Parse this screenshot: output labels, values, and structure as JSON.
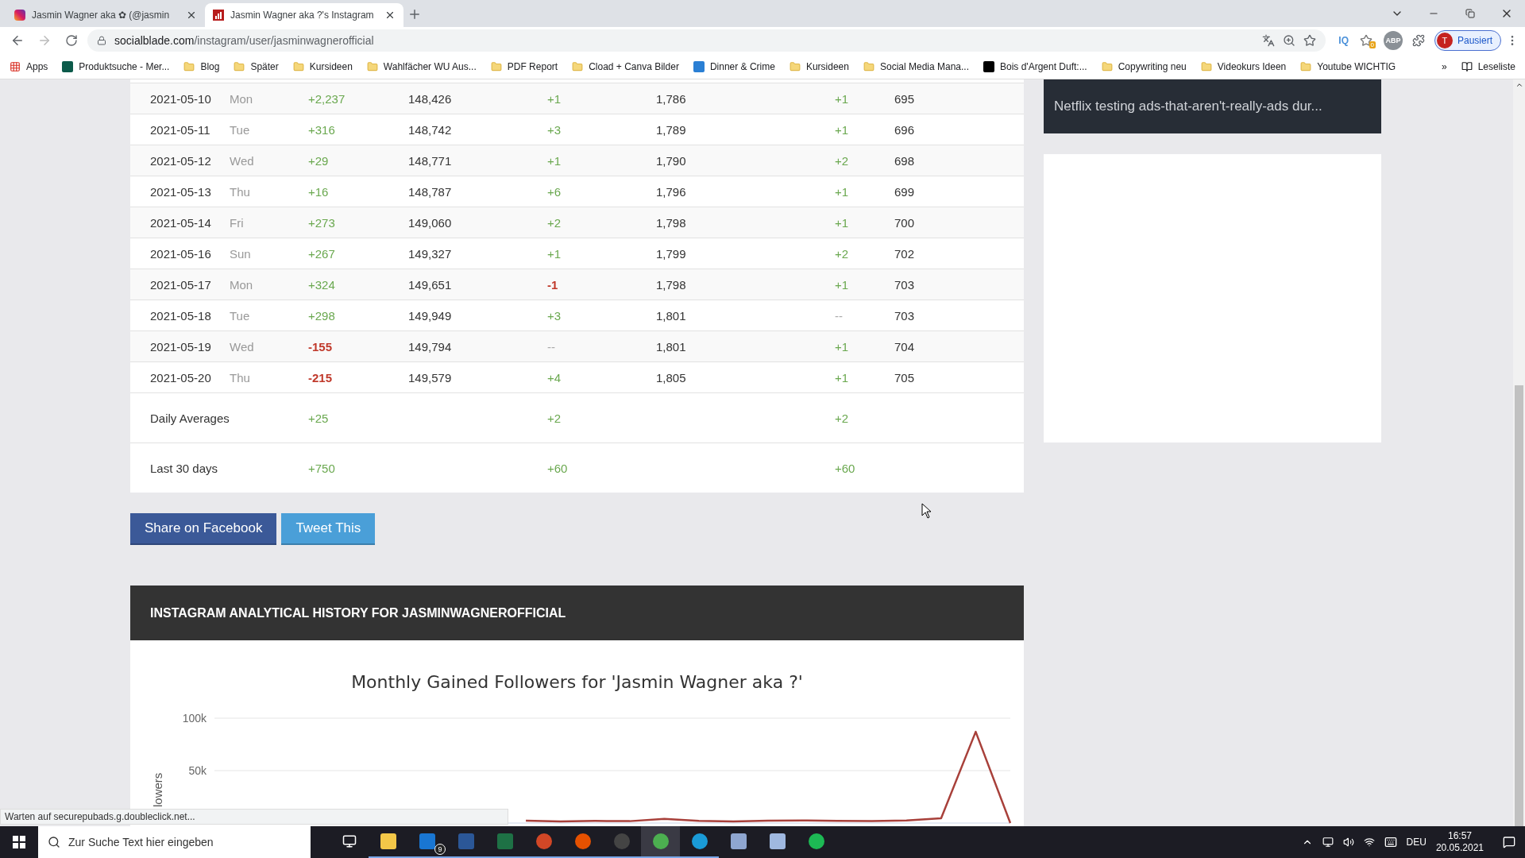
{
  "browser": {
    "tabs": [
      {
        "title": "Jasmin Wagner aka ✿ (@jasmin",
        "kind": "instagram",
        "selected": false
      },
      {
        "title": "Jasmin Wagner aka ?'s Instagram",
        "kind": "socialblade",
        "selected": true
      }
    ],
    "url": {
      "host": "socialblade.com",
      "path": "/instagram/user/jasminwagnerofficial"
    },
    "extensions": {
      "iq": "IQ",
      "badge": "0",
      "abp": "ABP"
    },
    "profile": {
      "initial": "T",
      "label": "Pausiert"
    },
    "bookmarks": [
      {
        "label": "Apps",
        "kind": "apps"
      },
      {
        "label": "Produktsuche - Mer...",
        "kind": "site"
      },
      {
        "label": "Blog",
        "kind": "folder"
      },
      {
        "label": "Später",
        "kind": "folder"
      },
      {
        "label": "Kursideen",
        "kind": "folder"
      },
      {
        "label": "Wahlfächer WU Aus...",
        "kind": "folder"
      },
      {
        "label": "PDF Report",
        "kind": "folder"
      },
      {
        "label": "Cload + Canva Bilder",
        "kind": "folder"
      },
      {
        "label": "Dinner & Crime",
        "kind": "jd"
      },
      {
        "label": "Kursideen",
        "kind": "folder"
      },
      {
        "label": "Social Media Mana...",
        "kind": "folder"
      },
      {
        "label": "Bois d'Argent Duft:...",
        "kind": "dark"
      },
      {
        "label": "Copywriting neu",
        "kind": "folder"
      },
      {
        "label": "Videokurs Ideen",
        "kind": "folder"
      },
      {
        "label": "Youtube WICHTIG",
        "kind": "folder"
      }
    ],
    "more": "»",
    "reading_list": "Leseliste"
  },
  "table": {
    "rows": [
      {
        "date": "2021-05-10",
        "day": "Mon",
        "followers_change": {
          "text": "+2,237",
          "kind": "gain"
        },
        "followers": "148,426",
        "following_change": {
          "text": "+1",
          "kind": "gain"
        },
        "following": "1,786",
        "media_change": {
          "text": "+1",
          "kind": "gain"
        },
        "media": "695"
      },
      {
        "date": "2021-05-11",
        "day": "Tue",
        "followers_change": {
          "text": "+316",
          "kind": "gain"
        },
        "followers": "148,742",
        "following_change": {
          "text": "+3",
          "kind": "gain"
        },
        "following": "1,789",
        "media_change": {
          "text": "+1",
          "kind": "gain"
        },
        "media": "696"
      },
      {
        "date": "2021-05-12",
        "day": "Wed",
        "followers_change": {
          "text": "+29",
          "kind": "gain"
        },
        "followers": "148,771",
        "following_change": {
          "text": "+1",
          "kind": "gain"
        },
        "following": "1,790",
        "media_change": {
          "text": "+2",
          "kind": "gain"
        },
        "media": "698"
      },
      {
        "date": "2021-05-13",
        "day": "Thu",
        "followers_change": {
          "text": "+16",
          "kind": "gain"
        },
        "followers": "148,787",
        "following_change": {
          "text": "+6",
          "kind": "gain"
        },
        "following": "1,796",
        "media_change": {
          "text": "+1",
          "kind": "gain"
        },
        "media": "699"
      },
      {
        "date": "2021-05-14",
        "day": "Fri",
        "followers_change": {
          "text": "+273",
          "kind": "gain"
        },
        "followers": "149,060",
        "following_change": {
          "text": "+2",
          "kind": "gain"
        },
        "following": "1,798",
        "media_change": {
          "text": "+1",
          "kind": "gain"
        },
        "media": "700"
      },
      {
        "date": "2021-05-16",
        "day": "Sun",
        "followers_change": {
          "text": "+267",
          "kind": "gain"
        },
        "followers": "149,327",
        "following_change": {
          "text": "+1",
          "kind": "gain"
        },
        "following": "1,799",
        "media_change": {
          "text": "+2",
          "kind": "gain"
        },
        "media": "702"
      },
      {
        "date": "2021-05-17",
        "day": "Mon",
        "followers_change": {
          "text": "+324",
          "kind": "gain"
        },
        "followers": "149,651",
        "following_change": {
          "text": "-1",
          "kind": "loss"
        },
        "following": "1,798",
        "media_change": {
          "text": "+1",
          "kind": "gain"
        },
        "media": "703"
      },
      {
        "date": "2021-05-18",
        "day": "Tue",
        "followers_change": {
          "text": "+298",
          "kind": "gain"
        },
        "followers": "149,949",
        "following_change": {
          "text": "+3",
          "kind": "gain"
        },
        "following": "1,801",
        "media_change": {
          "text": "--",
          "kind": "none"
        },
        "media": "703"
      },
      {
        "date": "2021-05-19",
        "day": "Wed",
        "followers_change": {
          "text": "-155",
          "kind": "loss"
        },
        "followers": "149,794",
        "following_change": {
          "text": "--",
          "kind": "none"
        },
        "following": "1,801",
        "media_change": {
          "text": "+1",
          "kind": "gain"
        },
        "media": "704"
      },
      {
        "date": "2021-05-20",
        "day": "Thu",
        "followers_change": {
          "text": "-215",
          "kind": "loss"
        },
        "followers": "149,579",
        "following_change": {
          "text": "+4",
          "kind": "gain"
        },
        "following": "1,805",
        "media_change": {
          "text": "+1",
          "kind": "gain"
        },
        "media": "705"
      }
    ],
    "summaries": [
      {
        "label": "Daily Averages",
        "followers_change": "+25",
        "following_change": "+2",
        "media_change": "+2"
      },
      {
        "label": "Last 30 days",
        "followers_change": "+750",
        "following_change": "+60",
        "media_change": "+60"
      }
    ]
  },
  "share_buttons": [
    {
      "label": "Share on Facebook",
      "kind": "facebook"
    },
    {
      "label": "Tweet This",
      "kind": "twitter"
    }
  ],
  "history": {
    "heading": "INSTAGRAM ANALYTICAL HISTORY FOR JASMINWAGNEROFFICIAL",
    "chart_data": {
      "type": "line",
      "title": "Monthly Gained Followers for 'Jasmin Wagner aka ?'",
      "ylabel": "lowers",
      "ylim": [
        0,
        100000
      ],
      "yticks": [
        {
          "value": 50000,
          "label": "50k"
        },
        {
          "value": 100000,
          "label": "100k"
        }
      ],
      "series": [
        {
          "color": "#a8403a",
          "values": [
            null,
            null,
            null,
            null,
            null,
            null,
            null,
            null,
            null,
            2200,
            1500,
            2000,
            1800,
            4000,
            2000,
            1500,
            2200,
            2500,
            2000,
            1800,
            2500,
            4500,
            87000,
            0
          ]
        }
      ]
    }
  },
  "sidebar": {
    "news": "Netflix testing ads-that-aren't-really-ads dur..."
  },
  "status": "Warten auf securepubads.g.doubleclick.net...",
  "taskbar": {
    "search_placeholder": "Zur Suche Text hier eingeben",
    "mail_badge": "9",
    "language": "DEU",
    "time": "16:57",
    "date": "20.05.2021"
  }
}
